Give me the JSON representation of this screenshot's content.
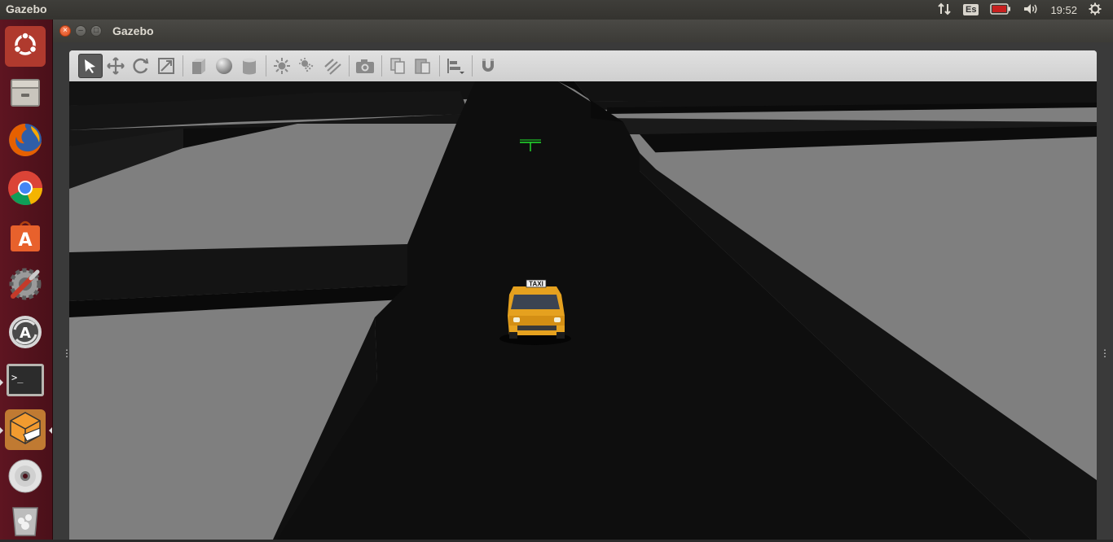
{
  "top_panel": {
    "app_name": "Gazebo",
    "keyboard_layout": "Es",
    "time": "19:52",
    "icons": [
      "network-icon",
      "keyboard-layout-indicator",
      "battery-icon",
      "volume-icon",
      "power-gear-icon"
    ]
  },
  "launcher": {
    "items": [
      {
        "name": "ubuntu-dash-icon",
        "color": "#e95420"
      },
      {
        "name": "files-icon",
        "color": "#b9b5ad"
      },
      {
        "name": "firefox-icon",
        "color": "#e66000"
      },
      {
        "name": "chrome-icon",
        "color": "#4285f4"
      },
      {
        "name": "software-center-icon",
        "color": "#e8612c"
      },
      {
        "name": "system-settings-icon",
        "color": "#888888"
      },
      {
        "name": "software-updater-icon",
        "color": "#555555"
      },
      {
        "name": "terminal-icon",
        "color": "#2d2d2d"
      },
      {
        "name": "gazebo-icon",
        "color": "#f29b2f"
      },
      {
        "name": "dvd-icon",
        "color": "#cccccc"
      },
      {
        "name": "trash-icon",
        "color": "#999999"
      }
    ]
  },
  "window": {
    "title": "Gazebo",
    "controls": [
      "close-button",
      "minimize-button",
      "maximize-button"
    ]
  },
  "toolbar": {
    "tools": [
      "select-mode-icon",
      "translate-mode-icon",
      "rotate-mode-icon",
      "scale-mode-icon",
      "box-shape-icon",
      "sphere-shape-icon",
      "cylinder-shape-icon",
      "point-light-icon",
      "spot-light-icon",
      "directional-light-icon",
      "screenshot-icon",
      "copy-icon",
      "paste-icon",
      "align-icon",
      "snap-icon"
    ],
    "active_tool": "select-mode-icon"
  },
  "scene": {
    "taxi_label": "TAXI",
    "road_color": "#0e0e0e",
    "block_color": "#7f7f7f",
    "taxi_color": "#e5a11f"
  }
}
